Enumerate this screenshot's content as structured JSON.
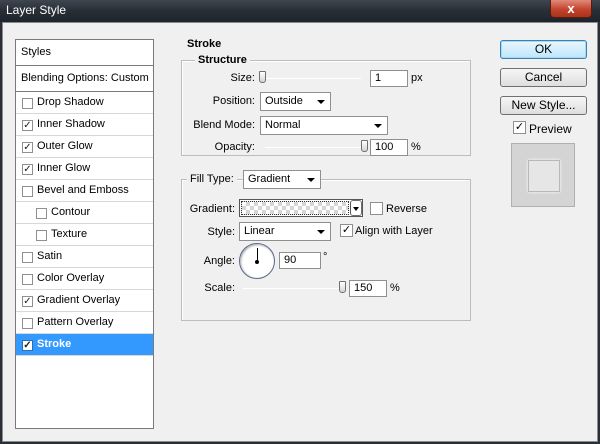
{
  "window": {
    "title": "Layer Style",
    "close_label": "x"
  },
  "sidebar": {
    "header": "Styles",
    "blending": "Blending Options: Custom",
    "items": [
      {
        "label": "Drop Shadow",
        "checked": false,
        "mark": ""
      },
      {
        "label": "Inner Shadow",
        "checked": true,
        "mark": "✓"
      },
      {
        "label": "Outer Glow",
        "checked": true,
        "mark": "✓"
      },
      {
        "label": "Inner Glow",
        "checked": true,
        "mark": "✓"
      },
      {
        "label": "Bevel and Emboss",
        "checked": false,
        "mark": ""
      },
      {
        "label": "Contour",
        "checked": false,
        "mark": ""
      },
      {
        "label": "Texture",
        "checked": false,
        "mark": ""
      },
      {
        "label": "Satin",
        "checked": false,
        "mark": ""
      },
      {
        "label": "Color Overlay",
        "checked": false,
        "mark": ""
      },
      {
        "label": "Gradient Overlay",
        "checked": true,
        "mark": "✓"
      },
      {
        "label": "Pattern Overlay",
        "checked": false,
        "mark": ""
      },
      {
        "label": "Stroke",
        "checked": true,
        "mark": "✓",
        "selected": true
      }
    ]
  },
  "stroke": {
    "title": "Stroke",
    "structure": {
      "title": "Structure",
      "size_label": "Size:",
      "size_value": "1",
      "size_unit": "px",
      "size_level": 0.0,
      "position_label": "Position:",
      "position_value": "Outside",
      "blend_label": "Blend Mode:",
      "blend_value": "Normal",
      "opacity_label": "Opacity:",
      "opacity_value": "100",
      "opacity_unit": "%",
      "opacity_level": 1.0
    },
    "fill": {
      "type_label": "Fill Type:",
      "type_value": "Gradient",
      "gradient_label": "Gradient:",
      "reverse_label": "Reverse",
      "reverse_checked": false,
      "style_label": "Style:",
      "style_value": "Linear",
      "align_label": "Align with Layer",
      "align_checked": true,
      "align_mark": "✓",
      "angle_label": "Angle:",
      "angle_value": "90",
      "angle_unit": "°",
      "scale_label": "Scale:",
      "scale_value": "150",
      "scale_unit": "%",
      "scale_level": 1.0
    }
  },
  "buttons": {
    "ok": "OK",
    "cancel": "Cancel",
    "new_style": "New Style...",
    "preview_label": "Preview",
    "preview_checked": true,
    "preview_mark": "✓"
  },
  "colors": {
    "selection": "#3399ff",
    "default_button_border": "#3c7fb1"
  }
}
